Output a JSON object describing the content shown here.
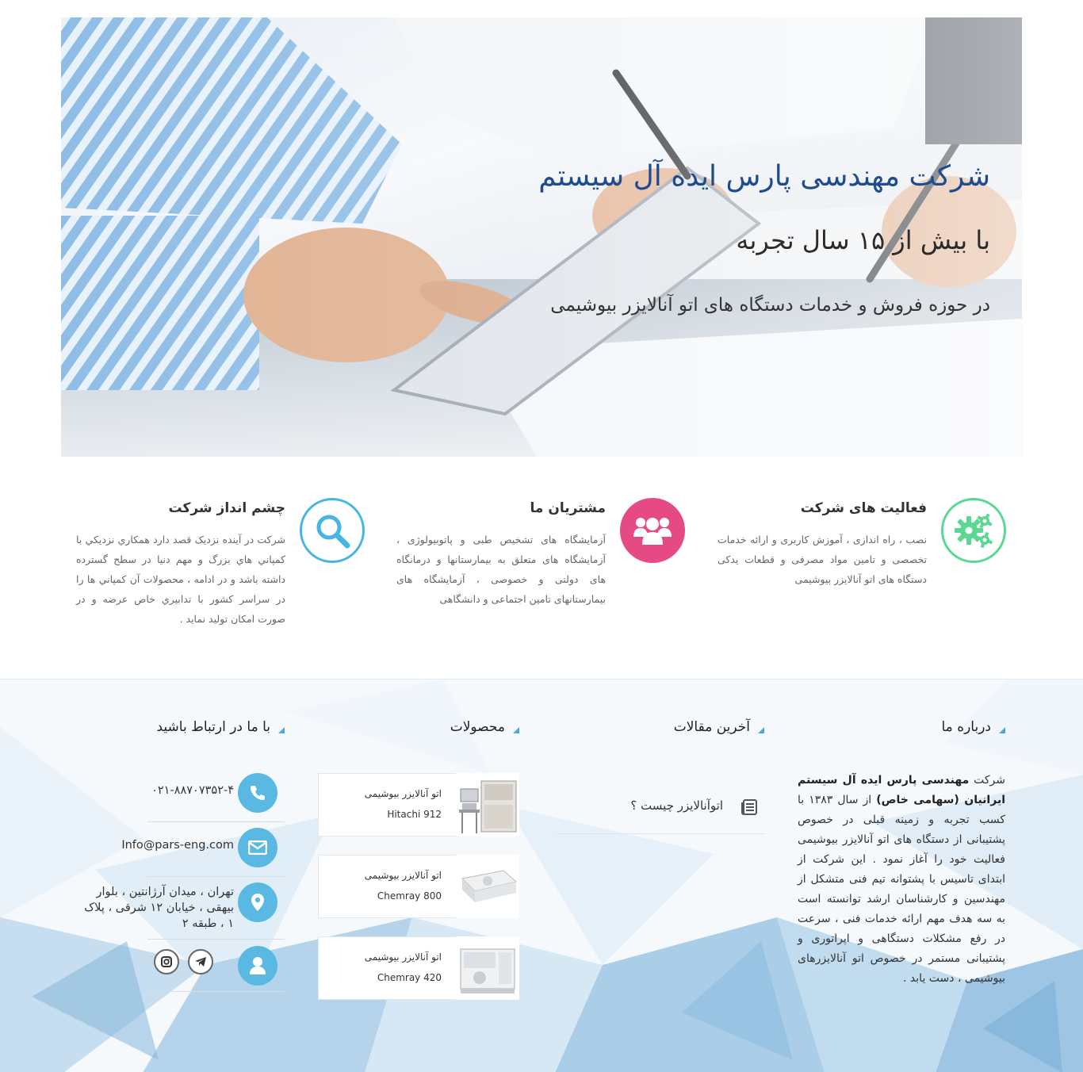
{
  "hero": {
    "title": "شرکت مهندسی پارس ایده آل سیستم",
    "subtitle": "با بیش از ۱۵ سال تجربه",
    "tagline": "در حوزه فروش و خدمات دستگاه های اتو آنالایزر بیوشیمی"
  },
  "features": [
    {
      "title": "فعالیت های شرکت",
      "icon": "gears-icon",
      "color": "#59d892",
      "text": "نصب ، راه اندازی ، آموزش کاربری و ارائه خدمات تخصصی و تامین مواد مصرفی و قطعات یدکی دستگاه های اتو آنالایزر بیوشیمی"
    },
    {
      "title": "مشتریان ما",
      "icon": "users-icon",
      "color": "#e64a85",
      "text": "آزمایشگاه های تشخیص طبی و پاتوبیولوژی ، آزمایشگاه های متعلق به بیمارستانها و درمانگاه های دولتی و خصوصی ، آزمایشگاه های بیمارستانهای تامین اجتماعی و دانشگاهی"
    },
    {
      "title": "چشم انداز شرکت",
      "icon": "search-icon",
      "color": "#45b6e2",
      "text": "شرکت در آینده نزديک قصد دارد همکاري نزديکي با کمپاني هاي بزرگ و مهم دنيا در سطح گسترده داشته باشد و در ادامه ، محصولات آن کمپاني ها را در سراسر کشور با تدابيري خاص عرضه و در صورت امکان توليد نمايد ."
    }
  ],
  "footer": {
    "about": {
      "heading": "درباره ما",
      "text_prefix": "شرکت ",
      "company_name": "مهندسی پارس ایده آل سیستم ایرانیان (سهامی خاص)",
      "text_body": " از سال ۱۳۸۳ با کسب تجربه و زمینه قبلی در خصوص پشتیبانی از دستگاه های اتو آنالایزر بیوشیمی فعالیت خود را آغاز نمود . این شرکت از ابتدای تاسیس با پشتوانه تیم فنی متشکل از مهندسین و کارشناسان ارشد توانسته است به سه هدف مهم ارائه خدمات فنی ، سرعت در رفع مشکلات دستگاهی و اپراتوری و پشتیبانی مستمر در خصوص اتو آنالایزرهای بیوشیمی ، دست یابد ."
    },
    "articles": {
      "heading": "آخرین مقالات",
      "items": [
        {
          "title": "اتوآنالایزر چیست ؟"
        }
      ]
    },
    "products": {
      "heading": "محصولات",
      "items": [
        {
          "name": "اتو آنالایزر بیوشیمی",
          "model": "Hitachi 912"
        },
        {
          "name": "اتو آنالایزر بیوشیمی",
          "model": "Chemray 800"
        },
        {
          "name": "اتو آنالایزر بیوشیمی",
          "model": "Chemray 420"
        }
      ]
    },
    "contact": {
      "heading": "با ما در ارتباط باشید",
      "phone": "۰۲۱-۸۸۷۰۷۳۵۲-۴",
      "email": "Info@pars-eng.com",
      "address": "تهران ، میدان آرژانتین ، بلوار بیهقی ، خیابان ۱۲ شرقی ، پلاک ۱ ، طبقه ۲",
      "icons": [
        "phone-icon",
        "envelope-icon",
        "map-marker-icon",
        "user-icon",
        "telegram-icon",
        "instagram-icon"
      ]
    }
  }
}
